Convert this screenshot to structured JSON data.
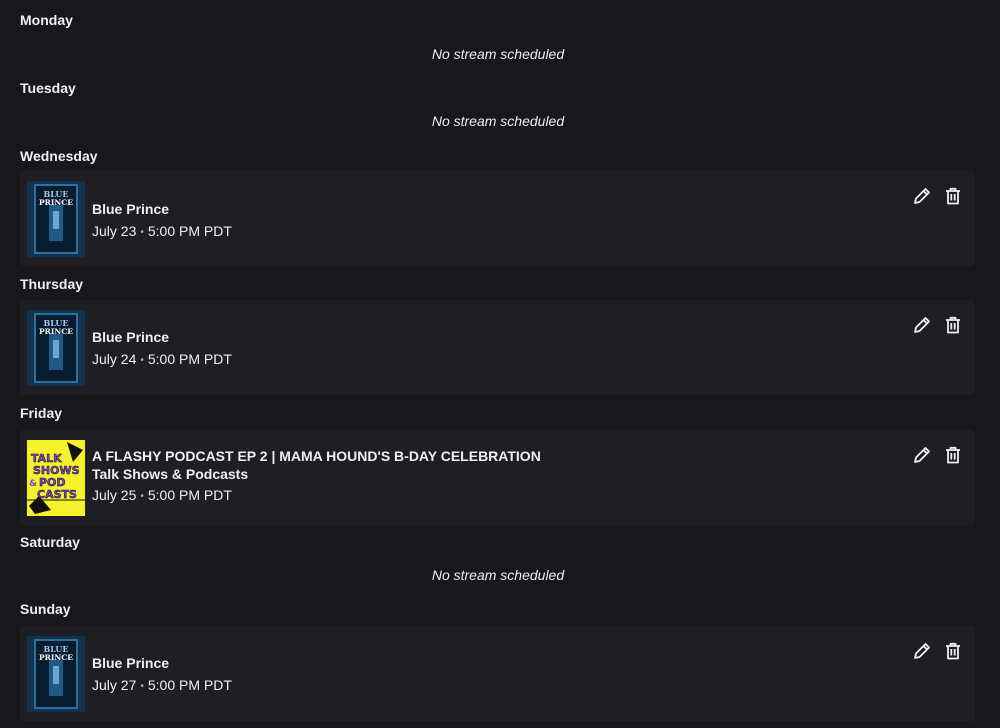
{
  "empty_text": "No stream scheduled",
  "days": {
    "monday": {
      "label": "Monday"
    },
    "tuesday": {
      "label": "Tuesday"
    },
    "wednesday": {
      "label": "Wednesday",
      "stream": {
        "title": "Blue Prince",
        "date": "July 23",
        "time": "5:00 PM PDT",
        "thumbnail": "blue-prince-cover"
      }
    },
    "thursday": {
      "label": "Thursday",
      "stream": {
        "title": "Blue Prince",
        "date": "July 24",
        "time": "5:00 PM PDT",
        "thumbnail": "blue-prince-cover"
      }
    },
    "friday": {
      "label": "Friday",
      "stream": {
        "title": "A FLASHY PODCAST EP 2 | MAMA HOUND'S B-DAY CELEBRATION",
        "category": "Talk Shows & Podcasts",
        "date": "July 25",
        "time": "5:00 PM PDT",
        "thumbnail": "talk-shows-podcasts-cover"
      }
    },
    "saturday": {
      "label": "Saturday"
    },
    "sunday": {
      "label": "Sunday",
      "stream": {
        "title": "Blue Prince",
        "date": "July 27",
        "time": "5:00 PM PDT",
        "thumbnail": "blue-prince-cover"
      }
    }
  },
  "cover_text": {
    "blue_prince": [
      "BLUE",
      "PRINCE"
    ],
    "talk_shows": [
      "TALK",
      "SHOWS",
      "&",
      "POD",
      "CASTS"
    ]
  },
  "separator": "•",
  "icons": {
    "edit": "pencil-icon",
    "delete": "trash-icon"
  },
  "colors": {
    "background": "#18181b",
    "card": "#1f1f23",
    "text": "#efeff1",
    "talk_cover": "#f5f12a",
    "talk_text": "#7a3fd8"
  }
}
